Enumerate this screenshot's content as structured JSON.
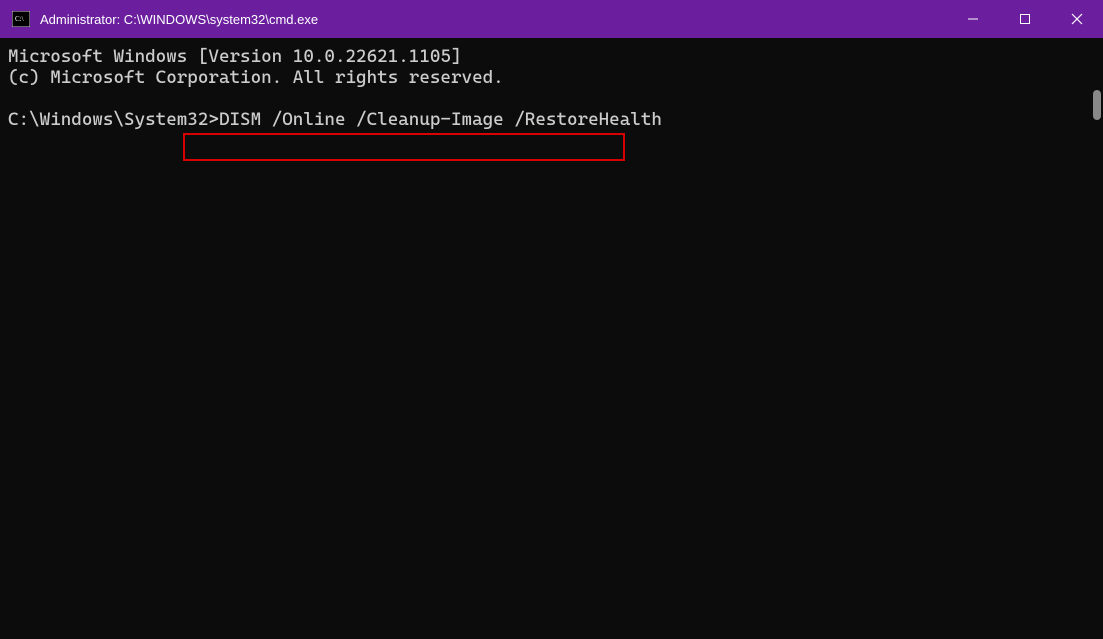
{
  "titlebar": {
    "title": "Administrator: C:\\WINDOWS\\system32\\cmd.exe"
  },
  "terminal": {
    "line1": "Microsoft Windows [Version 10.0.22621.1105]",
    "line2": "(c) Microsoft Corporation. All rights reserved.",
    "prompt": "C:\\Windows\\System32>",
    "command": "DISM /Online /Cleanup-Image /RestoreHealth"
  }
}
